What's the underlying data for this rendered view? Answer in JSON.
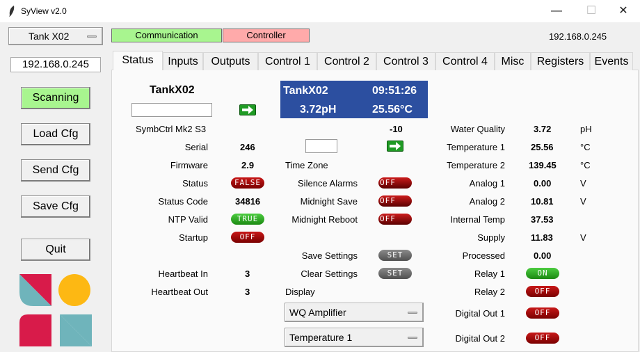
{
  "window": {
    "title": "SyView v2.0",
    "minimize": "—",
    "maximize": "☐",
    "close": "✕"
  },
  "top": {
    "device_select": "Tank X02",
    "communication": "Communication",
    "controller": "Controller",
    "ip_display": "192.168.0.245",
    "colors": {
      "communication": "#a8f58f",
      "controller": "#ffaaaa"
    }
  },
  "sidebar": {
    "ip": "192.168.0.245",
    "buttons": [
      "Scanning",
      "Load Cfg",
      "Send Cfg",
      "Save Cfg",
      "Quit"
    ]
  },
  "tabs": [
    "Status",
    "Inputs",
    "Outputs",
    "Control 1",
    "Control 2",
    "Control 3",
    "Control 4",
    "Misc",
    "Registers",
    "Events"
  ],
  "col1": {
    "title": "TankX02",
    "rows": [
      {
        "label": "SymbCtrl Mk2 S3",
        "value": ""
      },
      {
        "label": "Serial",
        "value": "246"
      },
      {
        "label": "Firmware",
        "value": "2.9"
      },
      {
        "label": "Status",
        "value": "FALSE"
      },
      {
        "label": "Status Code",
        "value": "34816"
      },
      {
        "label": "NTP Valid",
        "value": "TRUE"
      },
      {
        "label": "Startup",
        "value": "OFF"
      },
      {
        "label": "Heartbeat In",
        "value": "3"
      },
      {
        "label": "Heartbeat Out",
        "value": "3"
      }
    ]
  },
  "display_box": {
    "name": "TankX02",
    "time": "09:51:26",
    "ph": "3.72pH",
    "temp": "25.56°C"
  },
  "col2": {
    "offset": "-10",
    "time_zone": "Time Zone",
    "rows": [
      {
        "label": "Silence Alarms",
        "value": "OFF"
      },
      {
        "label": "Midnight Save",
        "value": "OFF"
      },
      {
        "label": "Midnight Reboot",
        "value": "OFF"
      },
      {
        "label": "Save Settings",
        "value": "SET"
      },
      {
        "label": "Clear Settings",
        "value": "SET"
      }
    ],
    "display_label": "Display",
    "display_select_1": "WQ Amplifier",
    "display_select_2": "Temperature 1"
  },
  "col3": {
    "rows": [
      {
        "label": "Water Quality",
        "value": "3.72",
        "unit": "pH"
      },
      {
        "label": "Temperature 1",
        "value": "25.56",
        "unit": "°C"
      },
      {
        "label": "Temperature 2",
        "value": "139.45",
        "unit": "°C"
      },
      {
        "label": "Analog 1",
        "value": "0.00",
        "unit": "V"
      },
      {
        "label": "Analog 2",
        "value": "10.81",
        "unit": "V"
      },
      {
        "label": "Internal Temp",
        "value": "37.53",
        "unit": ""
      },
      {
        "label": "Supply",
        "value": "11.83",
        "unit": "V"
      },
      {
        "label": "Processed",
        "value": "0.00",
        "unit": ""
      },
      {
        "label": "Relay 1",
        "value": "ON",
        "unit": ""
      },
      {
        "label": "Relay 2",
        "value": "OFF",
        "unit": ""
      },
      {
        "label": "Digital Out 1",
        "value": "OFF",
        "unit": ""
      },
      {
        "label": "Digital Out 2",
        "value": "OFF",
        "unit": ""
      }
    ]
  },
  "colors": {
    "accent_blue": "#2c4fa0",
    "pill_red": "#b00000",
    "pill_green": "#2ea82a",
    "logo_red": "#d81b4a",
    "logo_teal": "#6fb4bb",
    "logo_yellow": "#fdb813"
  }
}
